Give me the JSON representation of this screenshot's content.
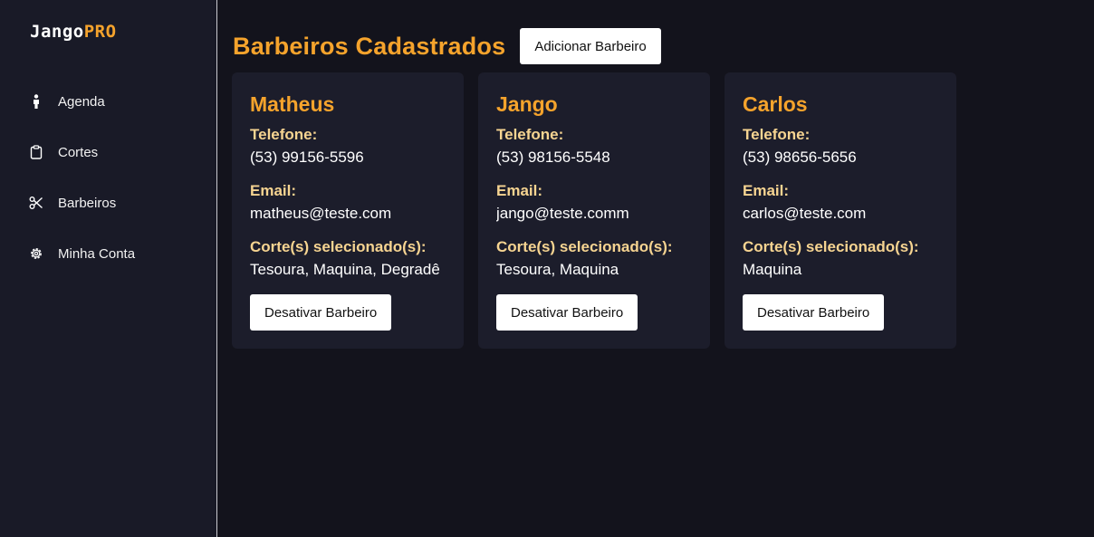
{
  "brand": {
    "name_main": "Jango",
    "name_accent": "PRO",
    "accent_color": "#f5a32c"
  },
  "sidebar": {
    "items": [
      {
        "label": "Agenda",
        "icon": "person-icon"
      },
      {
        "label": "Cortes",
        "icon": "clipboard-icon"
      },
      {
        "label": "Barbeiros",
        "icon": "scissors-icon"
      },
      {
        "label": "Minha Conta",
        "icon": "gear-icon"
      }
    ]
  },
  "main": {
    "title": "Barbeiros Cadastrados",
    "add_button_label": "Adicionar Barbeiro",
    "field_labels": {
      "phone": "Telefone:",
      "email": "Email:",
      "cuts": "Corte(s) selecionado(s):"
    },
    "deactivate_label": "Desativar Barbeiro",
    "barbers": [
      {
        "name": "Matheus",
        "phone": "(53) 99156-5596",
        "email": "matheus@teste.com",
        "cuts": "Tesoura, Maquina, Degradê"
      },
      {
        "name": "Jango",
        "phone": "(53) 98156-5548",
        "email": "jango@teste.comm",
        "cuts": "Tesoura, Maquina"
      },
      {
        "name": "Carlos",
        "phone": "(53) 98656-5656",
        "email": "carlos@teste.com",
        "cuts": "Maquina"
      }
    ]
  }
}
